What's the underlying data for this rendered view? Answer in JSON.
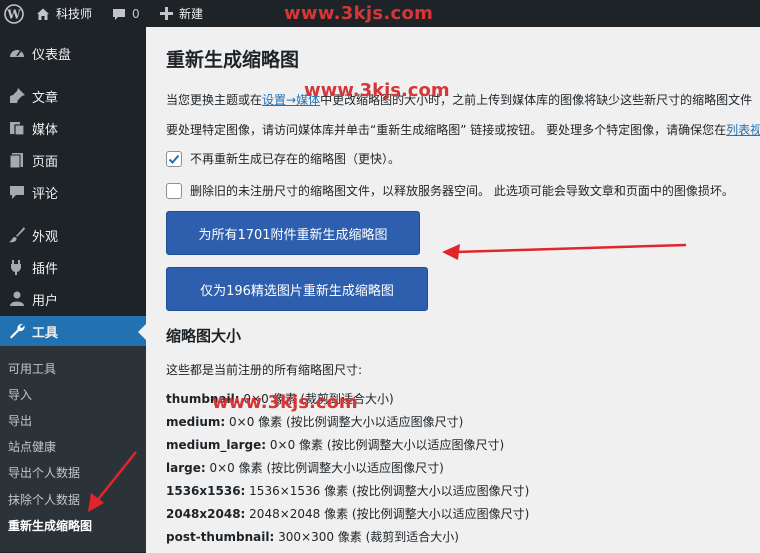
{
  "admin_bar": {
    "site_name": "科技师",
    "comments_count": "0",
    "new_label": "新建",
    "watermark": "www.3kjs.com"
  },
  "sidebar": {
    "items": [
      {
        "label": "仪表盘",
        "icon": "dashboard-icon"
      },
      {
        "label": "文章",
        "icon": "pin-icon"
      },
      {
        "label": "媒体",
        "icon": "media-icon"
      },
      {
        "label": "页面",
        "icon": "page-icon"
      },
      {
        "label": "评论",
        "icon": "comment-icon"
      },
      {
        "label": "外观",
        "icon": "brush-icon"
      },
      {
        "label": "插件",
        "icon": "plugin-icon"
      },
      {
        "label": "用户",
        "icon": "user-icon"
      },
      {
        "label": "工具",
        "icon": "wrench-icon"
      }
    ],
    "submenu": [
      "可用工具",
      "导入",
      "导出",
      "站点健康",
      "导出个人数据",
      "抹除个人数据",
      "重新生成缩略图"
    ]
  },
  "main": {
    "title": "重新生成缩略图",
    "para1_a": "当您更换主题或在",
    "para1_link": "设置→媒体",
    "para1_b": "中更改缩略图的大小时，之前上传到媒体库的图像将缺少这些新尺寸的缩略图文件",
    "para2_a": "要处理特定图像，请访问媒体库并单击“重新生成缩略图” 链接或按钮。 要处理多个特定图像，请确保您在",
    "para2_link": "列表视图",
    "checkbox1": {
      "label": "不再重新生成已存在的缩略图（更快）。",
      "checked": true
    },
    "checkbox2": {
      "label": "删除旧的未注册尺寸的缩略图文件，以释放服务器空间。 此选项可能会导致文章和页面中的图像损坏。",
      "checked": false
    },
    "button_all": "为所有1701附件重新生成缩略图",
    "button_featured": "仅为196精选图片重新生成缩略图",
    "section_title": "缩略图大小",
    "section_desc": "这些都是当前注册的所有缩略图尺寸:",
    "sizes": [
      {
        "name": "thumbnail:",
        "desc": "0×0 像素 (裁剪到适合大小)"
      },
      {
        "name": "medium:",
        "desc": "0×0 像素 (按比例调整大小以适应图像尺寸)"
      },
      {
        "name": "medium_large:",
        "desc": "0×0 像素 (按比例调整大小以适应图像尺寸)"
      },
      {
        "name": "large:",
        "desc": "0×0 像素 (按比例调整大小以适应图像尺寸)"
      },
      {
        "name": "1536x1536:",
        "desc": "1536×1536 像素 (按比例调整大小以适应图像尺寸)"
      },
      {
        "name": "2048x2048:",
        "desc": "2048×2048 像素 (按比例调整大小以适应图像尺寸)"
      },
      {
        "name": "post-thumbnail:",
        "desc": "300×300 像素 (裁剪到适合大小)"
      }
    ],
    "watermark_1": "www.3kjs.com",
    "watermark_2": "www.3kjs.com"
  },
  "colors": {
    "accent": "#2271b1",
    "button": "#2d5fae",
    "arrow": "#e0262b",
    "watermark": "#d63638"
  }
}
